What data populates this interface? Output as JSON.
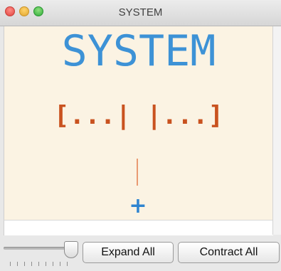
{
  "window": {
    "title": "SYSTEM"
  },
  "canvas": {
    "node_title": "SYSTEM",
    "node_brackets": "[...|  |...]",
    "add_symbol": "+"
  },
  "controls": {
    "expand_label": "Expand All",
    "contract_label": "Contract All"
  },
  "colors": {
    "title_blue": "#3d92d6",
    "bracket_orange": "#c9521f",
    "connector": "#e99a72",
    "canvas_bg": "#fbf3e3"
  }
}
